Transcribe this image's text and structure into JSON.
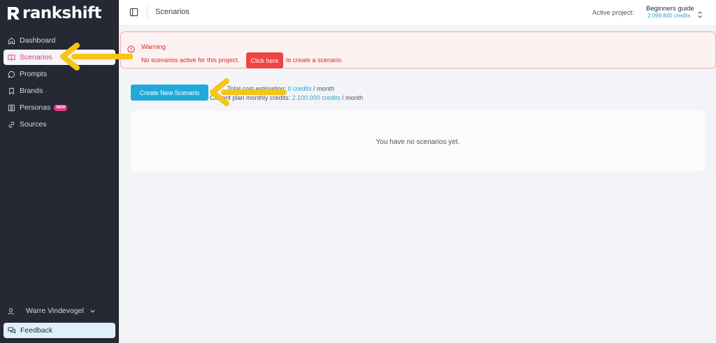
{
  "sidebar": {
    "logo": "rankshift",
    "items": [
      {
        "label": "Dashboard",
        "icon": "home-icon"
      },
      {
        "label": "Scenarios",
        "icon": "book-icon",
        "active": true
      },
      {
        "label": "Prompts",
        "icon": "chat-icon"
      },
      {
        "label": "Brands",
        "icon": "bookmark-icon"
      },
      {
        "label": "Personas",
        "icon": "person-card-icon",
        "badge": "NEW"
      },
      {
        "label": "Sources",
        "icon": "link-icon"
      }
    ],
    "user": "Warre Vindevogel",
    "feedback": "Feedback"
  },
  "header": {
    "title": "Scenarios",
    "active_project_label": "Active project:",
    "project_name": "Beginners guide",
    "project_credits": "2.099.840 credits"
  },
  "warning": {
    "title": "Warning",
    "text_before": "No scenarios active for this project.",
    "button": "Click here",
    "text_after": "to create a scenario."
  },
  "actions": {
    "create_button": "Create New Scenario",
    "cost_label": "Total cost estimation:",
    "cost_value": "0 credits",
    "cost_unit": "/ month",
    "plan_label": "Current plan monthly credits:",
    "plan_value": "2.100.000 credits",
    "plan_unit": "/ month"
  },
  "empty_state": "You have no scenarios yet.",
  "colors": {
    "sidebar_bg": "#262833",
    "accent_pink": "#e0348b",
    "accent_blue": "#22a9d9",
    "warning_red": "#ef4444",
    "arrow_yellow": "#f5c518"
  }
}
